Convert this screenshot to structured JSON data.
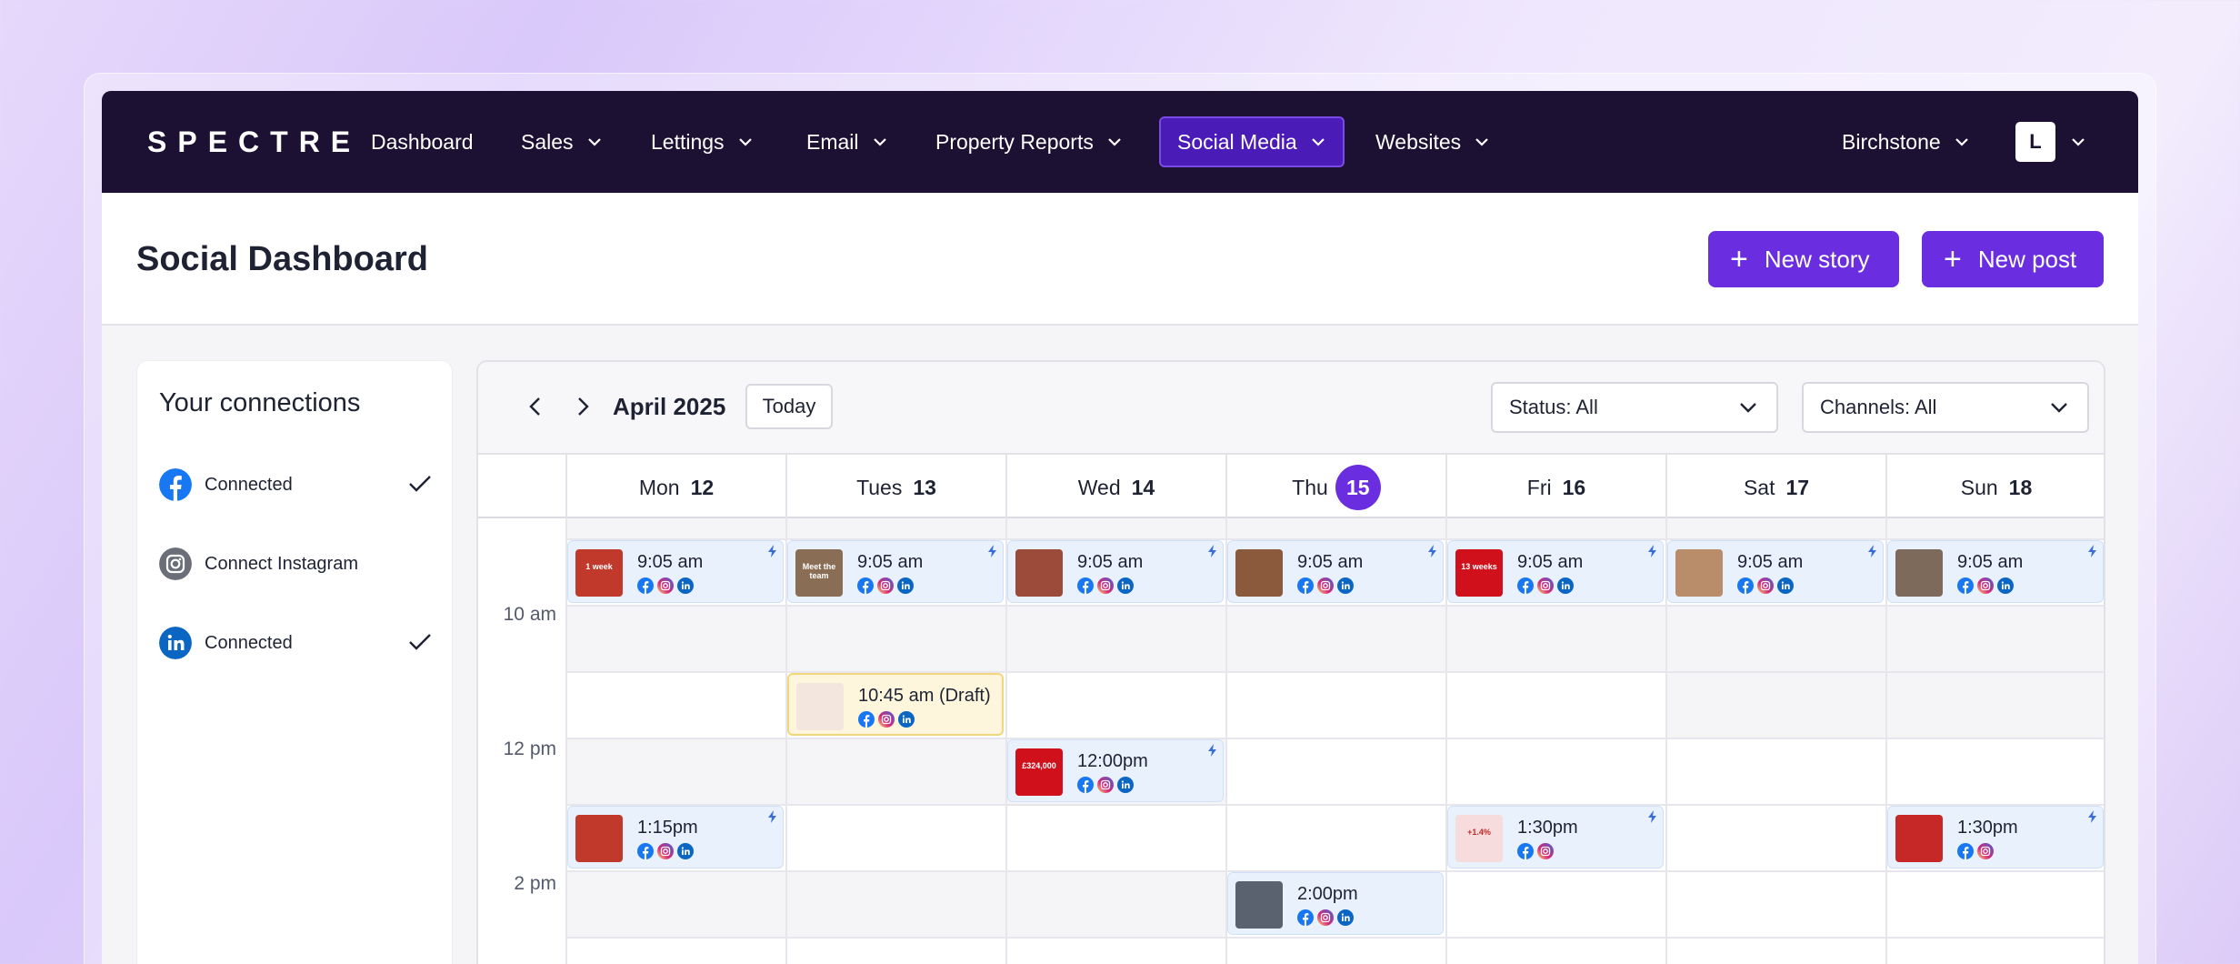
{
  "nav": {
    "logo": "SPECTRE",
    "items": [
      {
        "label": "Dashboard",
        "has_menu": false,
        "active": false
      },
      {
        "label": "Sales",
        "has_menu": true,
        "active": false
      },
      {
        "label": "Lettings",
        "has_menu": true,
        "active": false
      },
      {
        "label": "Email",
        "has_menu": true,
        "active": false
      },
      {
        "label": "Property Reports",
        "has_menu": true,
        "active": false
      },
      {
        "label": "Social Media",
        "has_menu": true,
        "active": true
      },
      {
        "label": "Websites",
        "has_menu": true,
        "active": false
      }
    ],
    "account": "Birchstone",
    "avatar_initial": "L"
  },
  "header": {
    "title": "Social Dashboard",
    "new_story_label": "New story",
    "new_post_label": "New post"
  },
  "connections": {
    "title": "Your connections",
    "items": [
      {
        "network": "facebook",
        "icon": "facebook-icon",
        "label": "Connected",
        "connected": true
      },
      {
        "network": "instagram",
        "icon": "instagram-icon",
        "label": "Connect Instagram",
        "connected": false
      },
      {
        "network": "linkedin",
        "icon": "linkedin-icon",
        "label": "Connected",
        "connected": true
      }
    ]
  },
  "calendar": {
    "month_label": "April 2025",
    "today_label": "Today",
    "status_filter": "Status: All",
    "channels_filter": "Channels: All",
    "days": [
      {
        "name": "Mon",
        "num": "12",
        "today": false
      },
      {
        "name": "Tues",
        "num": "13",
        "today": false
      },
      {
        "name": "Wed",
        "num": "14",
        "today": false
      },
      {
        "name": "Thu",
        "num": "15",
        "today": true
      },
      {
        "name": "Fri",
        "num": "16",
        "today": false
      },
      {
        "name": "Sat",
        "num": "17",
        "today": false
      },
      {
        "name": "Sun",
        "num": "18",
        "today": false
      }
    ],
    "time_labels": [
      "10 am",
      "12 pm",
      "2 pm"
    ],
    "events": [
      {
        "day": 0,
        "slot": 0,
        "time": "9:05 am",
        "channels": [
          "fb",
          "ig",
          "li"
        ],
        "thumb": "#c0392b",
        "thumb_text": "1 week",
        "auto": true,
        "draft": false
      },
      {
        "day": 1,
        "slot": 0,
        "time": "9:05 am",
        "channels": [
          "fb",
          "ig",
          "li"
        ],
        "thumb": "#8a6d55",
        "thumb_text": "Meet the team",
        "auto": true,
        "draft": false
      },
      {
        "day": 2,
        "slot": 0,
        "time": "9:05 am",
        "channels": [
          "fb",
          "ig",
          "li"
        ],
        "thumb": "#9c4a3a",
        "thumb_text": "",
        "auto": true,
        "draft": false
      },
      {
        "day": 3,
        "slot": 0,
        "time": "9:05 am",
        "channels": [
          "fb",
          "ig",
          "li"
        ],
        "thumb": "#8b5a3c",
        "thumb_text": "",
        "auto": true,
        "draft": false
      },
      {
        "day": 4,
        "slot": 0,
        "time": "9:05 am",
        "channels": [
          "fb",
          "ig",
          "li"
        ],
        "thumb": "#d0101b",
        "thumb_text": "13 weeks",
        "auto": true,
        "draft": false
      },
      {
        "day": 5,
        "slot": 0,
        "time": "9:05 am",
        "channels": [
          "fb",
          "ig",
          "li"
        ],
        "thumb": "#b98c6a",
        "thumb_text": "",
        "auto": true,
        "draft": false
      },
      {
        "day": 6,
        "slot": 0,
        "time": "9:05 am",
        "channels": [
          "fb",
          "ig",
          "li"
        ],
        "thumb": "#7d6a5b",
        "thumb_text": "",
        "auto": true,
        "draft": false
      },
      {
        "day": 1,
        "slot": 2,
        "time": "10:45 am (Draft)",
        "channels": [
          "fb",
          "ig",
          "li"
        ],
        "thumb": "#f2e6de",
        "thumb_text": "",
        "auto": false,
        "draft": true
      },
      {
        "day": 2,
        "slot": 3,
        "time": "12:00pm",
        "channels": [
          "fb",
          "ig",
          "li"
        ],
        "thumb": "#d0101b",
        "thumb_text": "£324,000",
        "auto": true,
        "draft": false
      },
      {
        "day": 0,
        "slot": 4,
        "time": "1:15pm",
        "channels": [
          "fb",
          "ig",
          "li"
        ],
        "thumb": "#c0392b",
        "thumb_text": "",
        "auto": true,
        "draft": false
      },
      {
        "day": 4,
        "slot": 4,
        "time": "1:30pm",
        "channels": [
          "fb",
          "ig"
        ],
        "thumb": "#f6dcdc",
        "thumb_text": "+1.4%",
        "auto": true,
        "draft": false
      },
      {
        "day": 6,
        "slot": 4,
        "time": "1:30pm",
        "channels": [
          "fb",
          "ig"
        ],
        "thumb": "#c62828",
        "thumb_text": "",
        "auto": true,
        "draft": false
      },
      {
        "day": 3,
        "slot": 5,
        "time": "2:00pm",
        "channels": [
          "fb",
          "ig",
          "li"
        ],
        "thumb": "#5a6270",
        "thumb_text": "",
        "auto": false,
        "draft": false
      }
    ]
  },
  "colors": {
    "nav_bg": "#1d1133",
    "accent": "#6a2ee0",
    "event_bg": "#e9f1fd",
    "draft_bg": "#fdf6dd",
    "facebook": "#1877f2",
    "instagram": "#d62976",
    "linkedin": "#0a66c2"
  }
}
